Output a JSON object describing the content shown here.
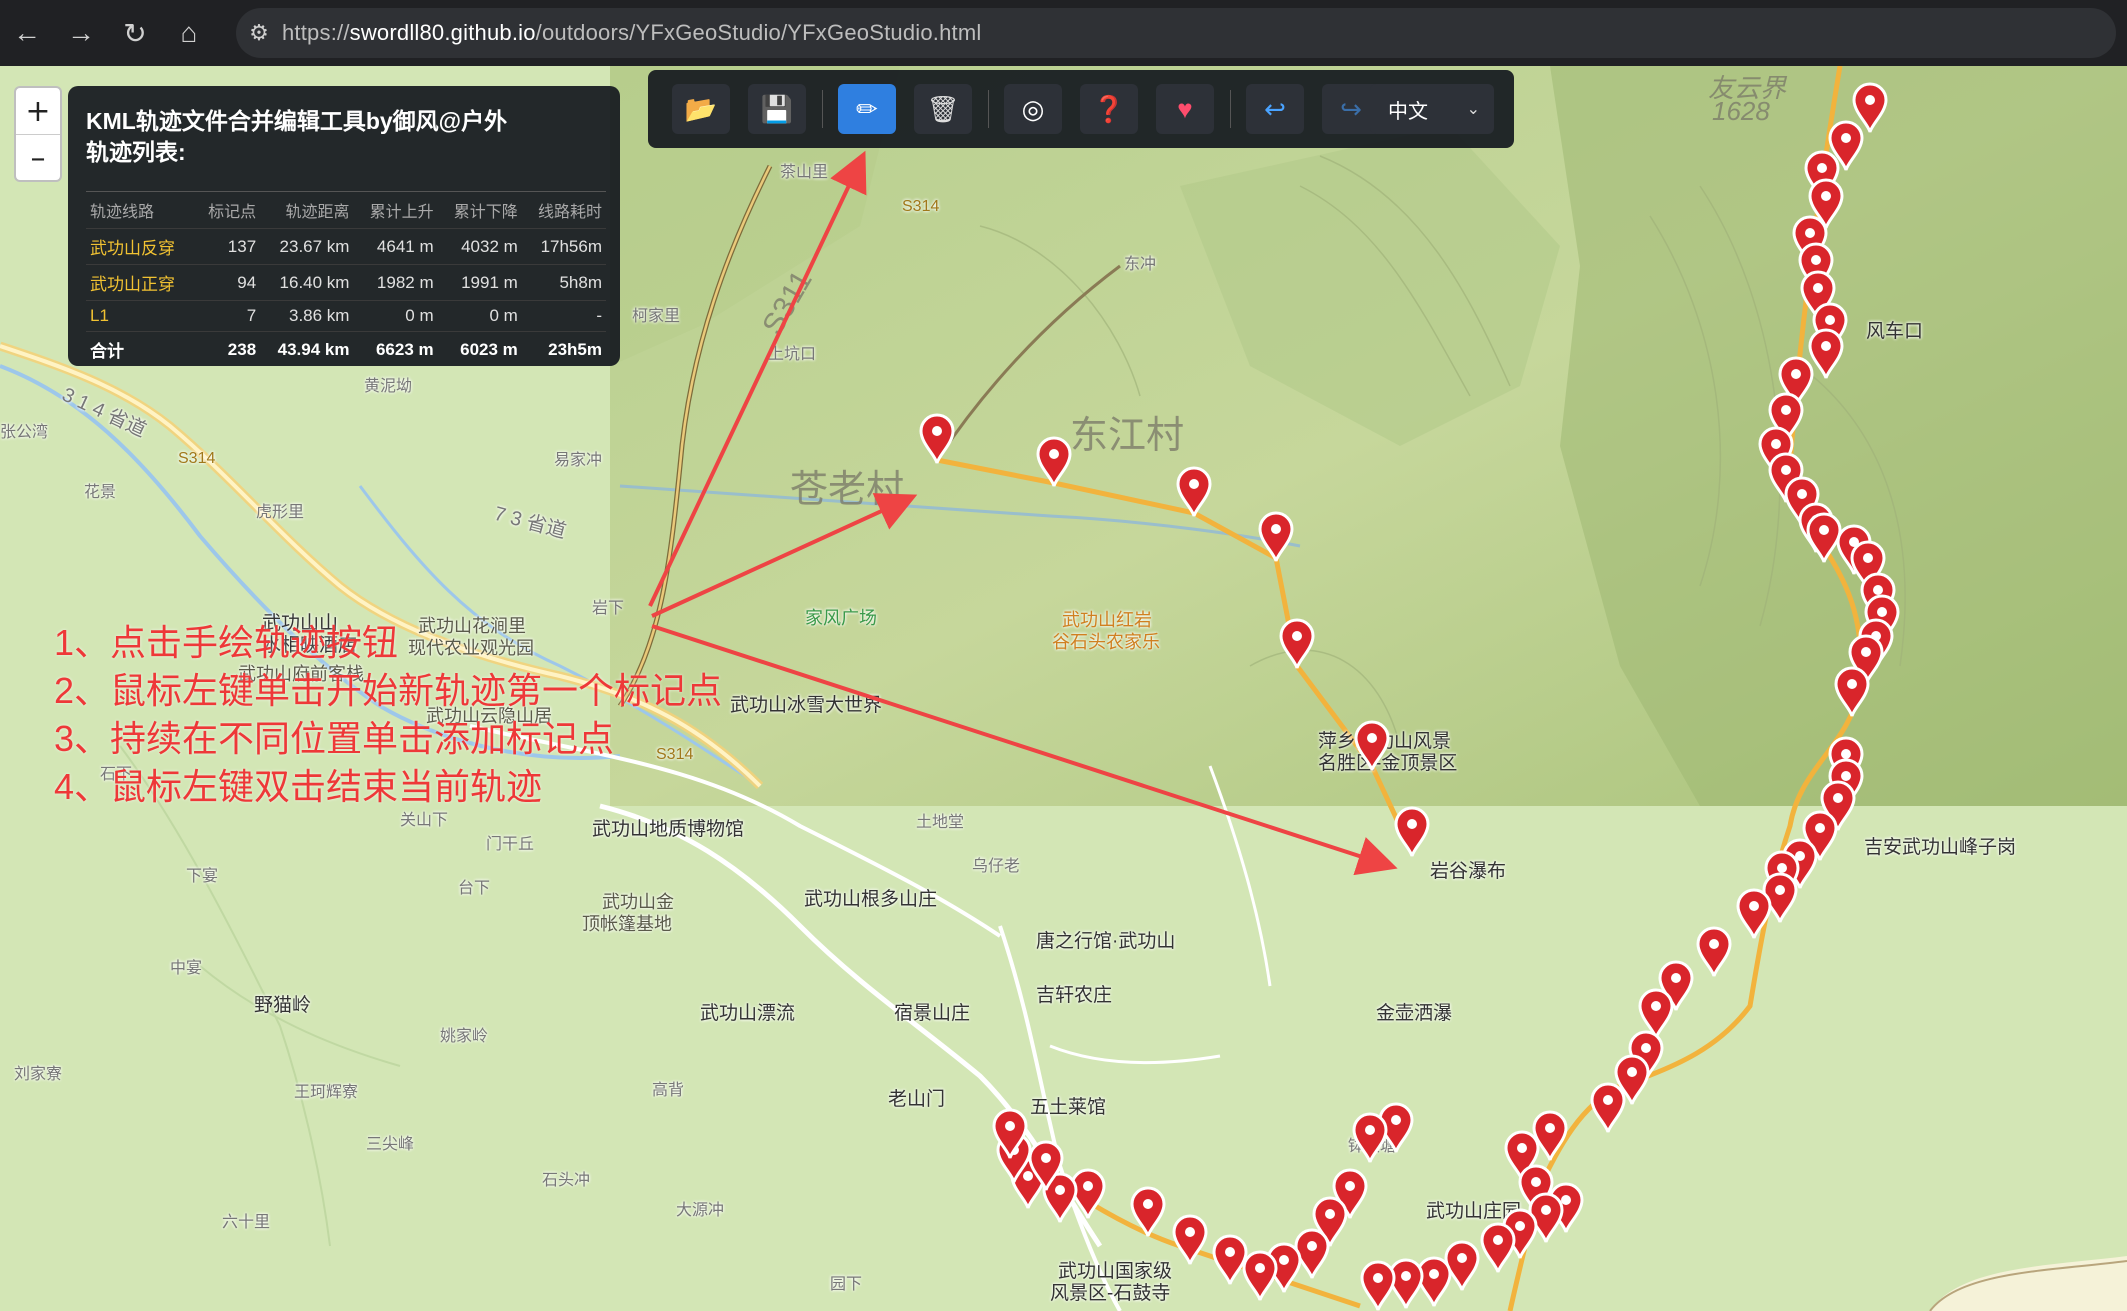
{
  "browser": {
    "url_prefix": "https://",
    "url_host": "swordll80.github.io",
    "url_path": "/outdoors/YFxGeoStudio/YFxGeoStudio.html"
  },
  "zoom": {
    "in": "+",
    "out": "–"
  },
  "panel": {
    "title_line1": "KML轨迹文件合并编辑工具by御风@户外",
    "title_line2": "轨迹列表:",
    "columns": [
      "轨迹线路",
      "标记点",
      "轨迹距离",
      "累计上升",
      "累计下降",
      "线路耗时"
    ],
    "rows": [
      [
        "武功山反穿",
        "137",
        "23.67 km",
        "4641 m",
        "4032 m",
        "17h56m"
      ],
      [
        "武功山正穿",
        "94",
        "16.40 km",
        "1982 m",
        "1991 m",
        "5h8m"
      ],
      [
        "L1",
        "7",
        "3.86 km",
        "0 m",
        "0 m",
        "-"
      ]
    ],
    "total": [
      "合计",
      "238",
      "43.94 km",
      "6623 m",
      "6023 m",
      "23h5m"
    ]
  },
  "toolbar": {
    "buttons": [
      {
        "name": "open-file-icon",
        "glyph": "📂"
      },
      {
        "name": "save-icon",
        "glyph": "💾"
      },
      {
        "name": "draw-track-icon",
        "glyph": "✏"
      },
      {
        "name": "delete-icon",
        "glyph": "🗑"
      },
      {
        "name": "target-icon",
        "glyph": "◎"
      },
      {
        "name": "help-icon",
        "glyph": "❓"
      },
      {
        "name": "heart-icon",
        "glyph": "♥"
      },
      {
        "name": "undo-icon",
        "glyph": "↩"
      },
      {
        "name": "redo-icon",
        "glyph": "↪"
      }
    ],
    "language": "中文"
  },
  "instructions": [
    "1、点击手绘轨迹按钮",
    "2、鼠标左键单击开始新轨迹第一个标记点",
    "3、持续在不同位置单击添加标记点",
    "4、鼠标左键双击结束当前轨迹"
  ],
  "map_labels": {
    "dongjiang": "东江村",
    "cailao": "苍老村",
    "jiafeng": "家风广场",
    "hongyan": "武功山红岩",
    "shitou": "谷石头农家乐",
    "fengjing": "萍乡武功山风景",
    "mingsheng": "名胜区-金顶景区",
    "pubu": "岩谷瀑布",
    "museum": "武功山地质博物馆",
    "bingxue": "武功山冰雪大世界",
    "genduo": "武功山根多山庄",
    "tangzhi": "唐之行馆·武功山",
    "jixuan": "吉轩农庄",
    "piaoliu": "武功山漂流",
    "sujing": "宿景山庄",
    "laoshanmen": "老山门",
    "wuwu": "五土莱馆",
    "guojia": "武功山国家级",
    "shigusi": "风景区-石鼓寺",
    "yemaoling": "野猫岭",
    "jinhu": "金壶洒瀑",
    "jian": "吉安武功山峰子岗",
    "fengchekou": "风车口",
    "shuixiang": "水相映酒店",
    "wugongshan": "武功山山",
    "huajianli": "武功山花涧里",
    "nongye": "现代农业观光园",
    "fudian": "武功山府前客栈",
    "yinshan": "武功山云隐山居",
    "jinding": "武功山金",
    "zhangpeng": "顶帐篷基地",
    "fayun": "友云界",
    "elev": "1628",
    "s314": "S314",
    "s311": "S311",
    "road314": "3 1 4 省道",
    "road373": "7 3 省道",
    "zhangjia": "张公湾",
    "huajing": "花景",
    "hushi": "虎形里",
    "huangni": "黄泥坳",
    "yijia": "易家冲",
    "chaxia": "茶山里",
    "kejia": "柯家里",
    "shangkeng": "上坑口",
    "shangyan": "岩下",
    "shixia": "石下",
    "guanshan": "关山下",
    "menggan": "门干丘",
    "taixia": "台下",
    "xiayuan": "下宴",
    "zhongsu": "中宴",
    "tujian": "土地堂",
    "wuzi": "乌仔老",
    "liujia": "刘家寮",
    "wangkeng": "王珂辉寮",
    "sanjian": "三尖峰",
    "liushi": "六十里",
    "shiliu": "石头冲",
    "dayuan": "大源冲",
    "yuanxia": "园下",
    "jiaojia": "姚家岭",
    "gaoshan": "高背",
    "chashan": "钵鞍塘",
    "dongdian": "东冲",
    "tuanzhu": "武功山庄园"
  }
}
